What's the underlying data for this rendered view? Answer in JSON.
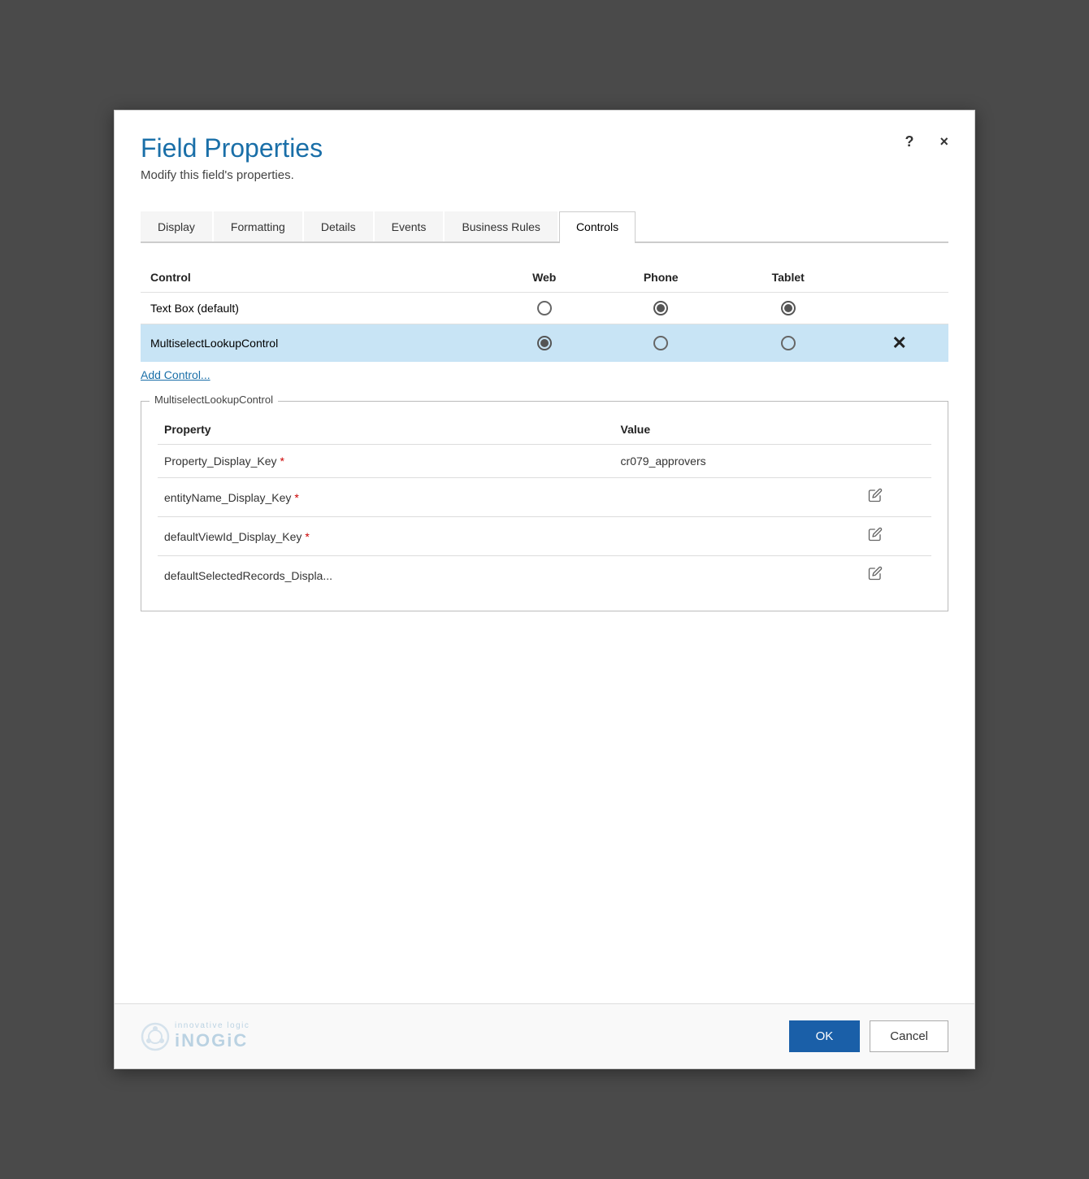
{
  "dialog": {
    "title": "Field Properties",
    "subtitle": "Modify this field's properties.",
    "help_label": "?",
    "close_label": "×"
  },
  "tabs": {
    "items": [
      {
        "id": "display",
        "label": "Display",
        "active": false
      },
      {
        "id": "formatting",
        "label": "Formatting",
        "active": false
      },
      {
        "id": "details",
        "label": "Details",
        "active": false
      },
      {
        "id": "events",
        "label": "Events",
        "active": false
      },
      {
        "id": "business_rules",
        "label": "Business Rules",
        "active": false
      },
      {
        "id": "controls",
        "label": "Controls",
        "active": true
      }
    ]
  },
  "controls_table": {
    "headers": {
      "control": "Control",
      "web": "Web",
      "phone": "Phone",
      "tablet": "Tablet"
    },
    "rows": [
      {
        "name": "Text Box (default)",
        "web_checked": false,
        "phone_checked": true,
        "tablet_checked": true,
        "selected": false,
        "deletable": false
      },
      {
        "name": "MultiselectLookupControl",
        "web_checked": true,
        "phone_checked": false,
        "tablet_checked": false,
        "selected": true,
        "deletable": true
      }
    ],
    "add_label": "Add Control..."
  },
  "properties_section": {
    "legend": "MultiselectLookupControl",
    "headers": {
      "property": "Property",
      "value": "Value"
    },
    "rows": [
      {
        "key": "Property_Display_Key",
        "required": true,
        "value": "cr079_approvers",
        "editable": false
      },
      {
        "key": "entityName_Display_Key",
        "required": true,
        "value": "",
        "editable": true
      },
      {
        "key": "defaultViewId_Display_Key",
        "required": true,
        "value": "",
        "editable": true
      },
      {
        "key": "defaultSelectedRecords_Displa...",
        "required": false,
        "value": "",
        "editable": true
      }
    ]
  },
  "footer": {
    "logo_top": "innovative logic",
    "logo_bottom": "iNOGiC",
    "ok_label": "OK",
    "cancel_label": "Cancel"
  }
}
